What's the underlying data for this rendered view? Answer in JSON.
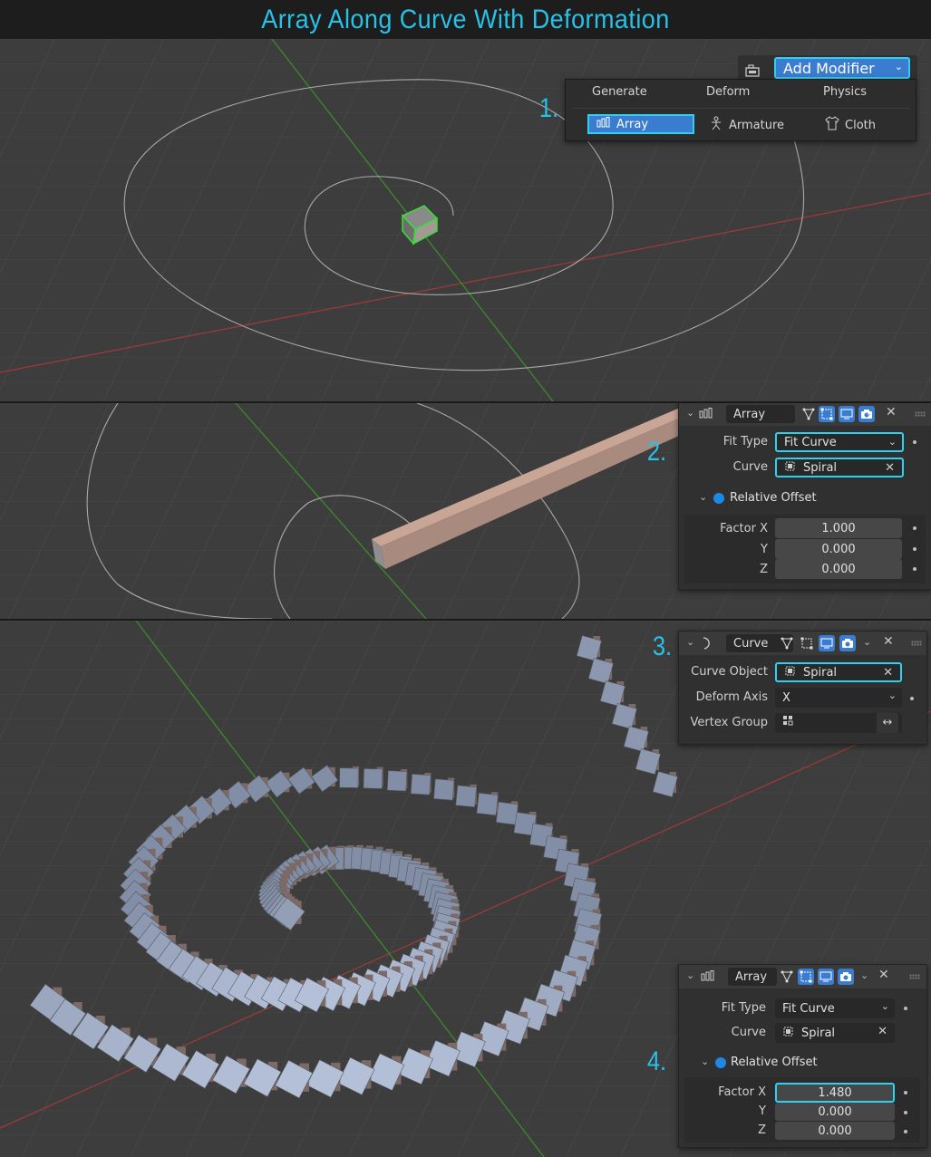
{
  "title": "Array Along Curve With Deformation",
  "steps": [
    "1.",
    "2.",
    "3.",
    "4."
  ],
  "panel1": {
    "add_modifier_label": "Add Modifier",
    "categories": [
      "Generate",
      "Deform",
      "Physics"
    ],
    "items": [
      "Array",
      "Armature",
      "Cloth"
    ]
  },
  "panel2": {
    "modifier_name": "Array",
    "fit_type_label": "Fit Type",
    "fit_type_value": "Fit Curve",
    "curve_label": "Curve",
    "curve_value": "Spiral",
    "relative_offset_label": "Relative Offset",
    "factor_x_label": "Factor X",
    "factor_x": "1.000",
    "y_label": "Y",
    "y_value": "0.000",
    "z_label": "Z",
    "z_value": "0.000"
  },
  "panel3": {
    "modifier_name": "Curve",
    "curve_object_label": "Curve Object",
    "curve_object_value": "Spiral",
    "deform_axis_label": "Deform Axis",
    "deform_axis_value": "X",
    "vertex_group_label": "Vertex Group"
  },
  "panel4": {
    "modifier_name": "Array",
    "fit_type_label": "Fit Type",
    "fit_type_value": "Fit Curve",
    "curve_label": "Curve",
    "curve_value": "Spiral",
    "relative_offset_label": "Relative Offset",
    "factor_x_label": "Factor X",
    "factor_x": "1.480",
    "y_label": "Y",
    "y_value": "0.000",
    "z_label": "Z",
    "z_value": "0.000"
  },
  "colors": {
    "accent": "#27c2e8",
    "highlight_border": "#2fd0f0",
    "toggle_on": "#3a7ccf",
    "viewport_bg": "#3d3d3d",
    "panel_bg": "#303030",
    "x_axis": "#9a3a3a",
    "y_axis": "#3c8a2c",
    "selection": "#34e034"
  }
}
